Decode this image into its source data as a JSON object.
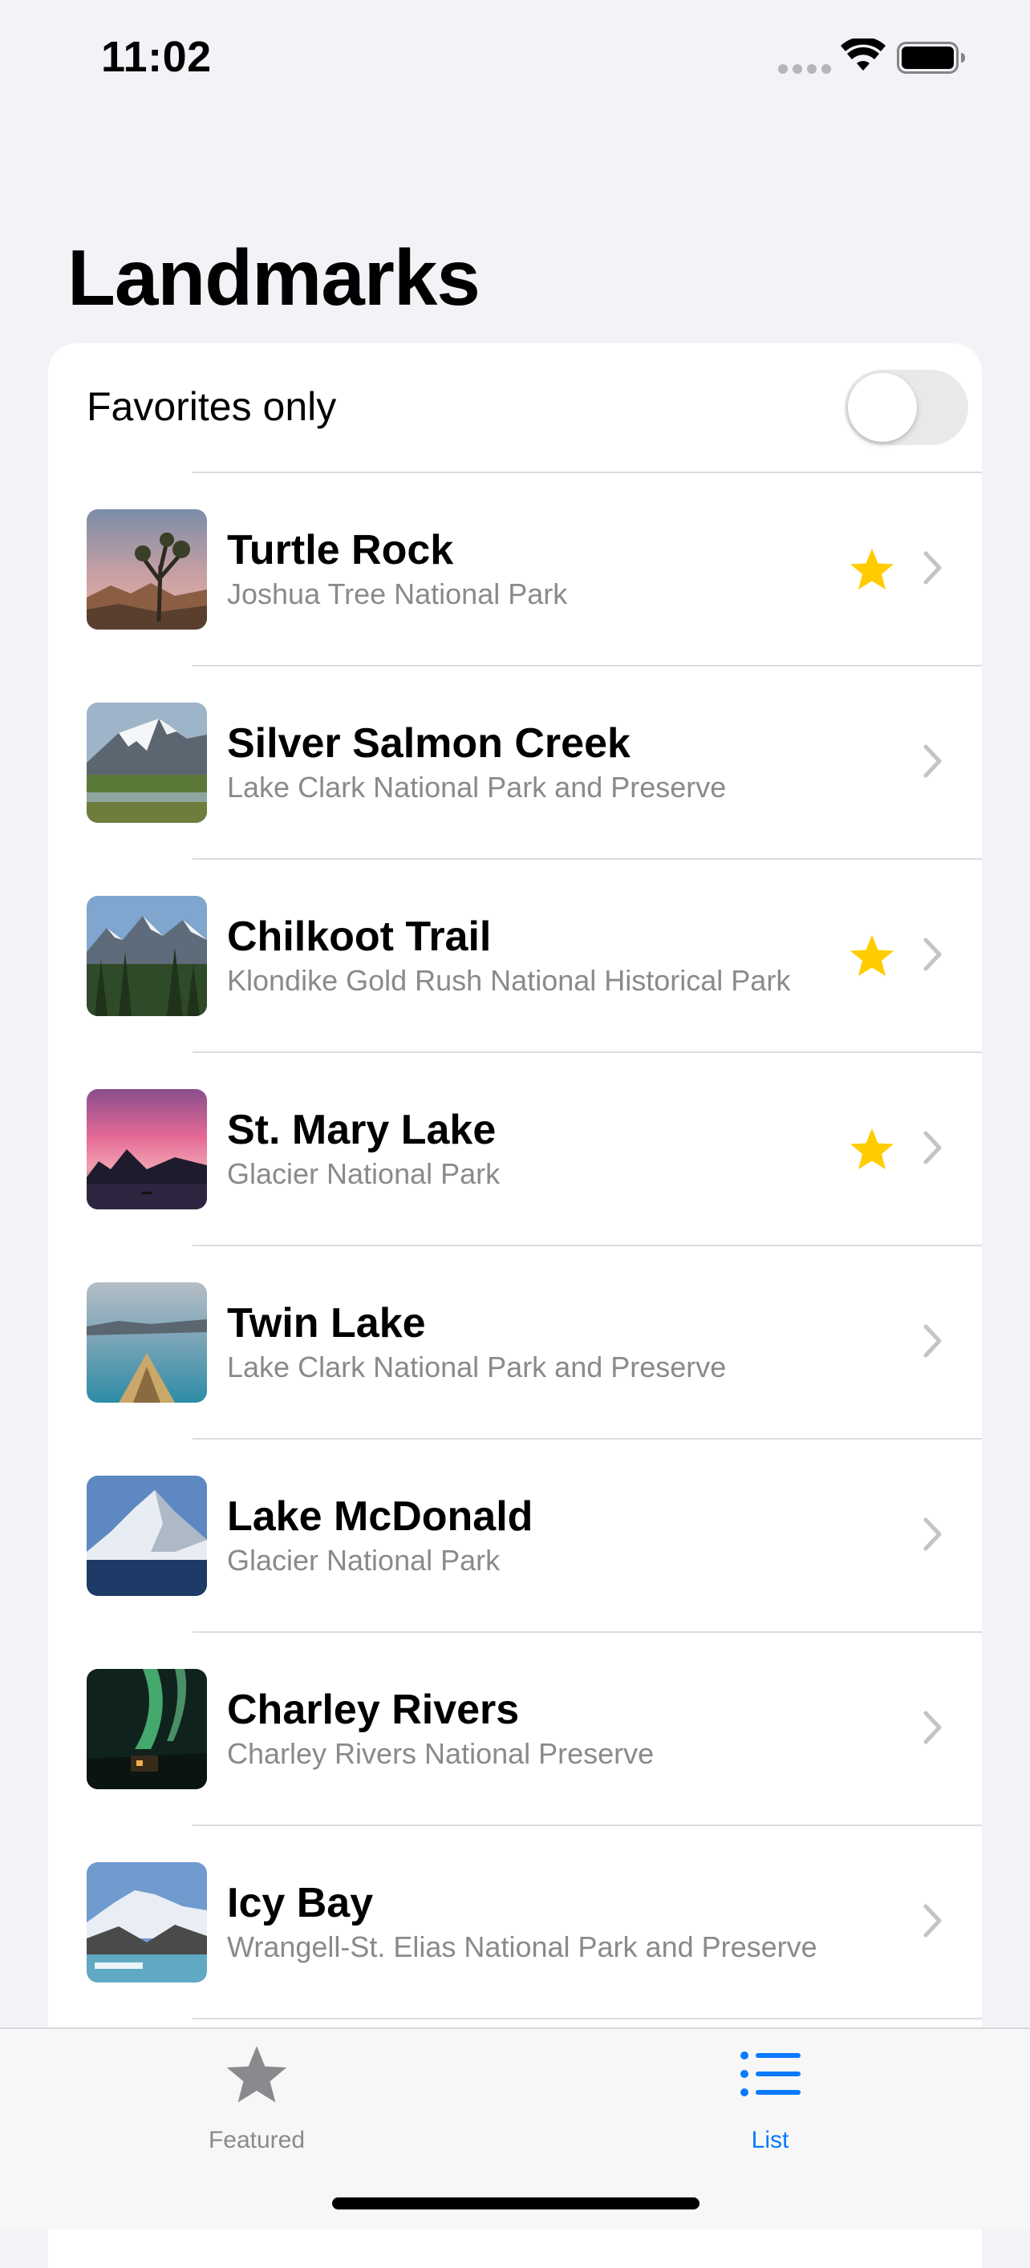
{
  "status_bar": {
    "time": "11:02"
  },
  "title": "Landmarks",
  "favorites_toggle": {
    "label": "Favorites only",
    "on": false
  },
  "landmarks": [
    {
      "name": "Turtle Rock",
      "park": "Joshua Tree National Park",
      "favorite": true
    },
    {
      "name": "Silver Salmon Creek",
      "park": "Lake Clark National Park and Preserve",
      "favorite": false
    },
    {
      "name": "Chilkoot Trail",
      "park": "Klondike Gold Rush National Historical Park",
      "favorite": true
    },
    {
      "name": "St. Mary Lake",
      "park": "Glacier National Park",
      "favorite": true
    },
    {
      "name": "Twin Lake",
      "park": "Lake Clark National Park and Preserve",
      "favorite": false
    },
    {
      "name": "Lake McDonald",
      "park": "Glacier National Park",
      "favorite": false
    },
    {
      "name": "Charley Rivers",
      "park": "Charley Rivers National Preserve",
      "favorite": false
    },
    {
      "name": "Icy Bay",
      "park": "Wrangell-St. Elias National Park and Preserve",
      "favorite": false
    }
  ],
  "tabs": [
    {
      "label": "Featured",
      "icon": "star-icon",
      "selected": false
    },
    {
      "label": "List",
      "icon": "list-icon",
      "selected": true
    }
  ],
  "colors": {
    "accent": "#0A7AFF",
    "favorite": "#FFCC00",
    "inactive_tab": "#8A8A8E"
  }
}
